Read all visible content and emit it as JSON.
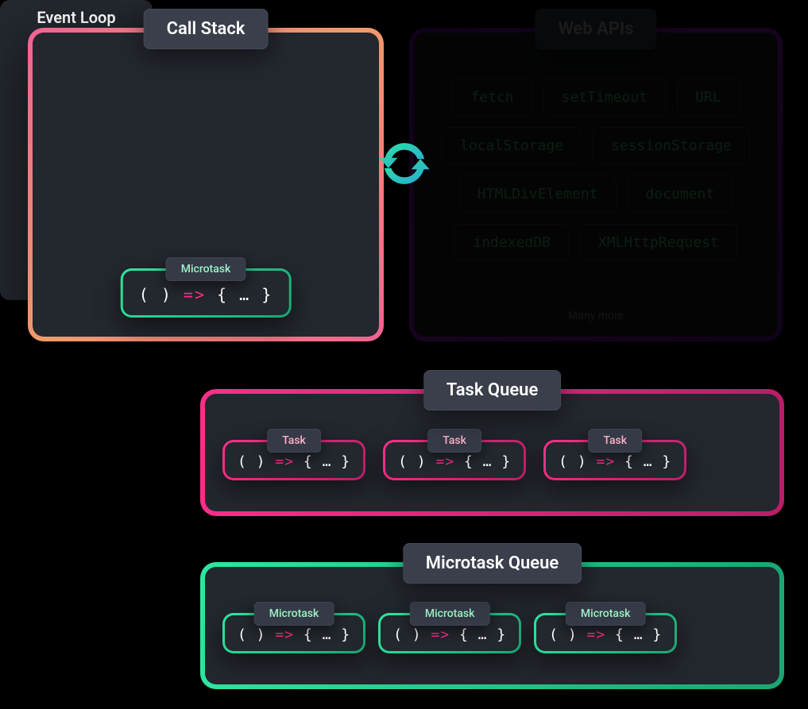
{
  "call_stack": {
    "title": "Call Stack",
    "item": {
      "chip": "Microtask",
      "code_left": "( )",
      "code_arrow": "=>",
      "code_right": "{ … }"
    }
  },
  "web_apis": {
    "title": "Web APIs",
    "items": [
      "fetch",
      "setTimeout",
      "URL",
      "localStorage",
      "sessionStorage",
      "HTMLDivElement",
      "document",
      "indexedDB",
      "XMLHttpRequest"
    ],
    "more": "Many more"
  },
  "event_loop": {
    "title": "Event Loop"
  },
  "task_queue": {
    "title": "Task Queue",
    "items": [
      {
        "chip": "Task",
        "code_left": "( )",
        "code_arrow": "=>",
        "code_right": "{ … }"
      },
      {
        "chip": "Task",
        "code_left": "( )",
        "code_arrow": "=>",
        "code_right": "{ … }"
      },
      {
        "chip": "Task",
        "code_left": "( )",
        "code_arrow": "=>",
        "code_right": "{ … }"
      }
    ]
  },
  "microtask_queue": {
    "title": "Microtask Queue",
    "items": [
      {
        "chip": "Microtask",
        "code_left": "( )",
        "code_arrow": "=>",
        "code_right": "{ … }"
      },
      {
        "chip": "Microtask",
        "code_left": "( )",
        "code_arrow": "=>",
        "code_right": "{ … }"
      },
      {
        "chip": "Microtask",
        "code_left": "( )",
        "code_arrow": "=>",
        "code_right": "{ … }"
      }
    ]
  }
}
